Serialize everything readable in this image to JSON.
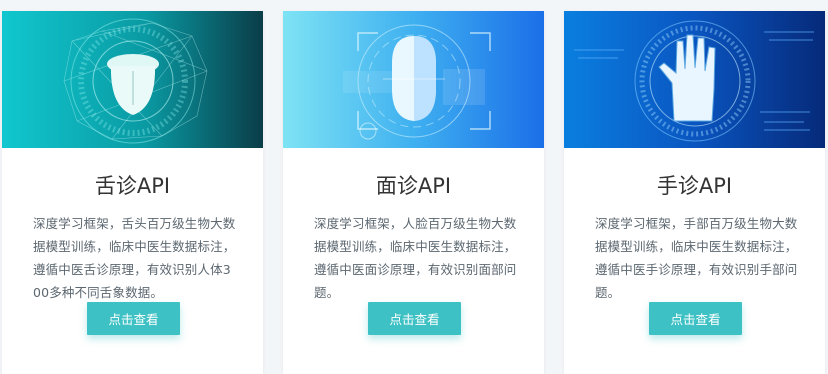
{
  "cards": [
    {
      "title": "舌诊API",
      "description": "深度学习框架，舌头百万级生物大数据模型训练，临床中医生数据标注，遵循中医舌诊原理，有效识别人体300多种不同舌象数据。",
      "button_label": "点击查看",
      "image_icon": "tongue-icon",
      "colors": {
        "from": "#11c7cf",
        "to": "#0a3d48"
      }
    },
    {
      "title": "面诊API",
      "description": "深度学习框架，人脸百万级生物大数据模型训练，临床中医生数据标注，遵循中医面诊原理，有效识别面部问题。",
      "button_label": "点击查看",
      "image_icon": "face-icon",
      "colors": {
        "from": "#7ee3f4",
        "to": "#1b6fe8"
      }
    },
    {
      "title": "手诊API",
      "description": "深度学习框架，手部百万级生物大数据模型训练，临床中医生数据标注，遵循中医手诊原理，有效识别手部问题。",
      "button_label": "点击查看",
      "image_icon": "palm-icon",
      "colors": {
        "from": "#0a7fe0",
        "to": "#062a7a"
      }
    }
  ],
  "accent_color": "#3ec1c4"
}
